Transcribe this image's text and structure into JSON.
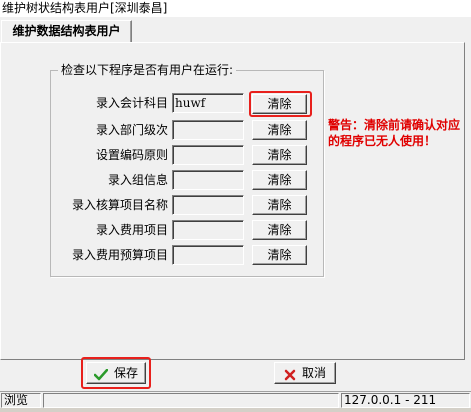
{
  "window": {
    "title": "维护树状结构表用户[深圳泰昌]"
  },
  "tab": {
    "label": "维护数据结构表用户"
  },
  "group": {
    "title": "检查以下程序是否有用户在运行:",
    "clear_label": "清除",
    "rows": [
      {
        "label": "录入会计科目",
        "value": "huwf"
      },
      {
        "label": "录入部门级次",
        "value": ""
      },
      {
        "label": "设置编码原则",
        "value": ""
      },
      {
        "label": "录入组信息",
        "value": ""
      },
      {
        "label": "录入核算项目名称",
        "value": ""
      },
      {
        "label": "录入费用项目",
        "value": ""
      },
      {
        "label": "录入费用预算项目",
        "value": ""
      }
    ]
  },
  "warning": {
    "text": "警告：清除前请确认对应的程序已无人使用！"
  },
  "buttons": {
    "save_label": "保存",
    "cancel_label": "取消"
  },
  "status": {
    "left": "浏览",
    "middle": "",
    "right": "127.0.0.1 - 211"
  },
  "colors": {
    "highlight": "#e8201c",
    "warning": "#e00000",
    "save_icon": "#2a9a2a",
    "cancel_icon": "#d02020"
  }
}
